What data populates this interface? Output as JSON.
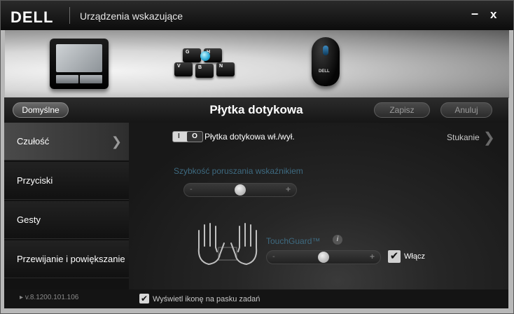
{
  "window": {
    "logo": "DELL",
    "title": "Urządzenia wskazujące",
    "minimize": "–",
    "close": "x"
  },
  "devices": {
    "keys": [
      "G",
      "H",
      "V",
      "B",
      "N"
    ],
    "mouse_brand": "DELL"
  },
  "header": {
    "default_label": "Domyślne",
    "page_title": "Płytka dotykowa",
    "save_label": "Zapisz",
    "cancel_label": "Anuluj"
  },
  "sidebar": {
    "items": [
      {
        "label": "Czułość",
        "active": true
      },
      {
        "label": "Przyciski",
        "active": false
      },
      {
        "label": "Gesty",
        "active": false
      },
      {
        "label": "Przewijanie i powiększanie",
        "active": false
      }
    ]
  },
  "content": {
    "toggle_on": "I",
    "toggle_off": "O",
    "toggle_label": "Płytka dotykowa wł./wył.",
    "tapping_label": "Stukanie",
    "speed_label": "Szybkość poruszania wskaźnikiem",
    "speed_value": 0.5,
    "minus": "-",
    "plus": "+",
    "touchguard_label": "TouchGuard™",
    "info": "i",
    "touchguard_value": 0.5,
    "enable_label": "Włącz",
    "enable_checked": true
  },
  "footer": {
    "version": "v.8.1200.101.106",
    "taskbar_label": "Wyświetl ikonę na pasku zadań",
    "taskbar_checked": true
  },
  "colors": {
    "accent_label": "#3e6a80",
    "trackpoint": "#2aa9d6"
  }
}
